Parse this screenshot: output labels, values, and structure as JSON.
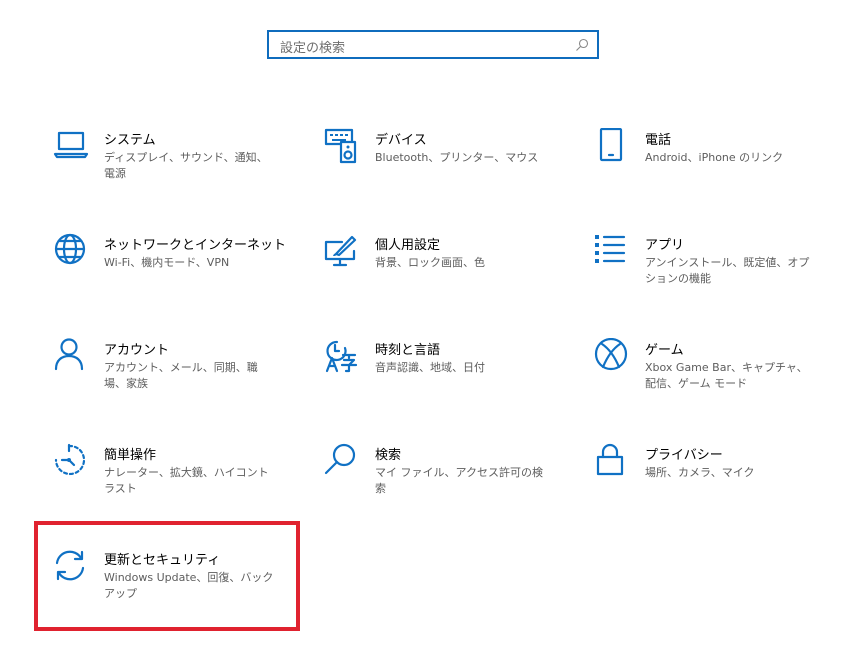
{
  "search": {
    "placeholder": "設定の検索",
    "icon": "search-icon"
  },
  "colors": {
    "accent": "#1071c4",
    "highlight": "#e0222f"
  },
  "categories": [
    {
      "title": "システム",
      "desc": "ディスプレイ、サウンド、通知、電源",
      "icon": "laptop-icon"
    },
    {
      "title": "デバイス",
      "desc": "Bluetooth、プリンター、マウス",
      "icon": "keyboard-speaker-icon"
    },
    {
      "title": "電話",
      "desc": "Android、iPhone のリンク",
      "icon": "phone-icon"
    },
    {
      "title": "ネットワークとインターネット",
      "desc": "Wi-Fi、機内モード、VPN",
      "icon": "globe-icon"
    },
    {
      "title": "個人用設定",
      "desc": "背景、ロック画面、色",
      "icon": "paint-monitor-icon"
    },
    {
      "title": "アプリ",
      "desc": "アンインストール、既定値、オプションの機能",
      "icon": "apps-list-icon"
    },
    {
      "title": "アカウント",
      "desc": "アカウント、メール、同期、職場、家族",
      "icon": "person-icon"
    },
    {
      "title": "時刻と言語",
      "desc": "音声認識、地域、日付",
      "icon": "time-language-icon"
    },
    {
      "title": "ゲーム",
      "desc": "Xbox Game Bar、キャプチャ、配信、ゲーム モード",
      "icon": "xbox-icon"
    },
    {
      "title": "簡単操作",
      "desc": "ナレーター、拡大鏡、ハイコントラスト",
      "icon": "ease-of-access-icon"
    },
    {
      "title": "検索",
      "desc": "マイ ファイル、アクセス許可の検索",
      "icon": "search-icon"
    },
    {
      "title": "プライバシー",
      "desc": "場所、カメラ、マイク",
      "icon": "lock-icon"
    },
    {
      "title": "更新とセキュリティ",
      "desc": "Windows Update、回復、バックアップ",
      "icon": "sync-icon"
    }
  ]
}
